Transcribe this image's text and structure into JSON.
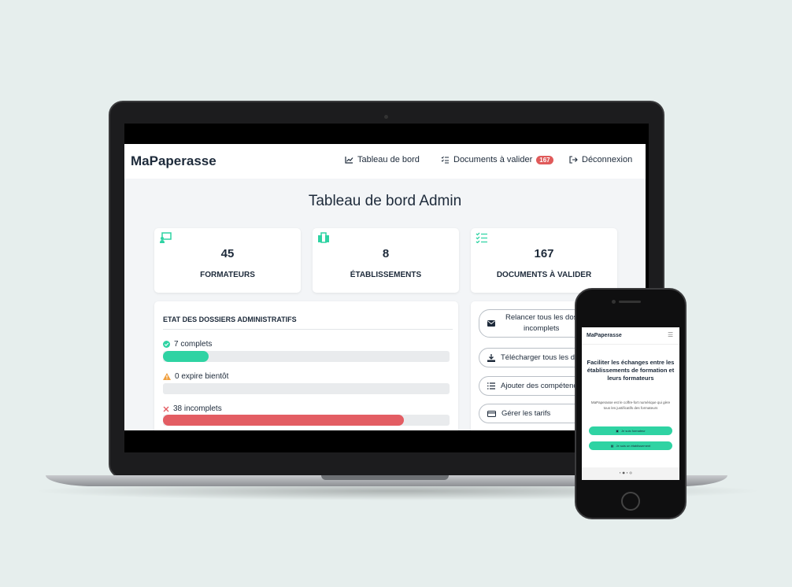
{
  "app": {
    "logo": "MaPaperasse",
    "nav": {
      "dashboard": "Tableau de bord",
      "documents": "Documents à valider",
      "documents_badge": "167",
      "logout": "Déconnexion"
    },
    "page_title": "Tableau de bord Admin",
    "stats": [
      {
        "value": "45",
        "label": "FORMATEURS",
        "icon": "chalkboard-teacher-icon"
      },
      {
        "value": "8",
        "label": "ÉTABLISSEMENTS",
        "icon": "buildings-icon"
      },
      {
        "value": "167",
        "label": "DOCUMENTS À VALIDER",
        "icon": "checklist-icon"
      }
    ],
    "dossiers": {
      "title": "ETAT DES DOSSIERS ADMINISTRATIFS",
      "rows": [
        {
          "label": "7 complets",
          "icon": "check-circle-icon",
          "fraction": 0.16,
          "color": "#2fd3a3"
        },
        {
          "label": "0 expire bientôt",
          "icon": "warning-icon",
          "fraction": 0,
          "color": "#f0a040"
        },
        {
          "label": "38 incomplets",
          "icon": "cross-icon",
          "fraction": 0.84,
          "color": "#e35d63"
        }
      ]
    },
    "actions": {
      "relaunch_line1": "Relancer tous les dos",
      "relaunch_line2": "incomplets",
      "download": "Télécharger tous les do",
      "add_skills": "Ajouter des compétenc",
      "manage_rates": "Gérer les tarifs"
    }
  },
  "mobile": {
    "logo": "MaPaperasse",
    "headline": "Faciliter les échanges entre les établissements de formation et leurs formateurs",
    "text": "MaPaperasse est le coffre-fort numérique qui gère tous les justificatifs des formateurs",
    "btn_formateur": "Je suis formateur",
    "btn_etablissement": "Je suis un établissement"
  },
  "colors": {
    "accent": "#2fd3a3",
    "danger": "#e35d63",
    "warning": "#f0a040",
    "text": "#1d2a3a"
  }
}
